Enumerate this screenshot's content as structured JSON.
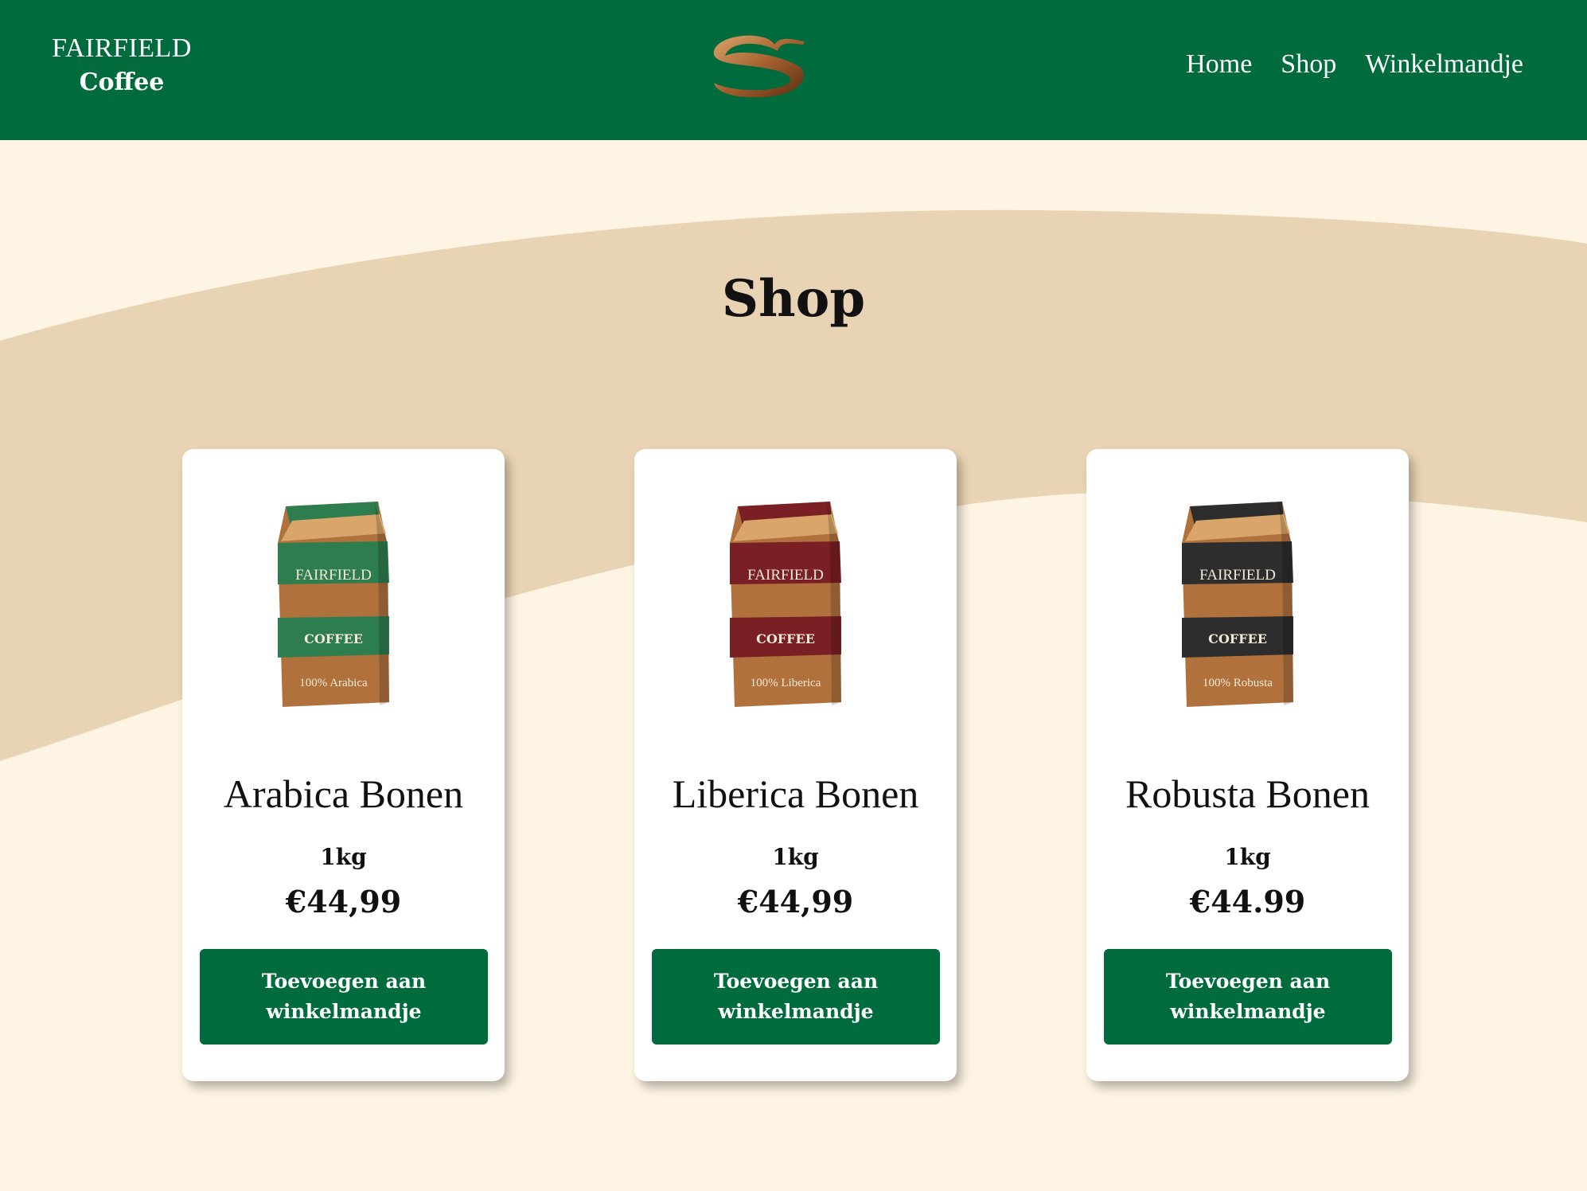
{
  "header": {
    "brand_line1": "FAIRFIELD",
    "brand_line2": "Coffee",
    "logo_icon": "coffee-swirl-logo",
    "nav": [
      {
        "label": "Home"
      },
      {
        "label": "Shop"
      },
      {
        "label": "Winkelmandje"
      }
    ]
  },
  "main": {
    "title": "Shop"
  },
  "products": [
    {
      "name": "Arabica Bonen",
      "weight": "1kg",
      "price": "€44,99",
      "button_label": "Toevoegen aan winkelmandje",
      "bag": {
        "brand": "FAIRFIELD",
        "label": "COFFEE",
        "variety": "100% Arabica",
        "color": "#2e7d4f"
      }
    },
    {
      "name": "Liberica Bonen",
      "weight": "1kg",
      "price": "€44,99",
      "button_label": "Toevoegen aan winkelmandje",
      "bag": {
        "brand": "FAIRFIELD",
        "label": "COFFEE",
        "variety": "100% Liberica",
        "color": "#7a1f24"
      }
    },
    {
      "name": "Robusta Bonen",
      "weight": "1kg",
      "price": "€44.99",
      "button_label": "Toevoegen aan winkelmandje",
      "bag": {
        "brand": "FAIRFIELD",
        "label": "COFFEE",
        "variety": "100% Robusta",
        "color": "#2d2d2d"
      }
    }
  ],
  "colors": {
    "header_green": "#006b3c",
    "background_cream": "#fdf4e3",
    "wave_tan": "#e8d4b4",
    "coffee_brown": "#b0713d"
  }
}
